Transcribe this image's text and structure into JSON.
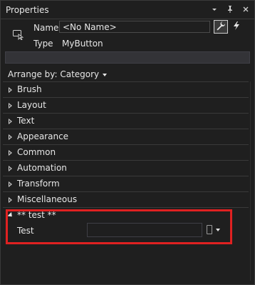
{
  "window": {
    "title": "Properties",
    "controls": [
      {
        "name": "dropdown-caret",
        "glyph": "▾"
      },
      {
        "name": "pin",
        "glyph": "📌"
      },
      {
        "name": "close",
        "glyph": "✕"
      }
    ]
  },
  "header": {
    "name_label": "Name",
    "name_value": "<No Name>",
    "type_label": "Type",
    "type_value": "MyButton",
    "properties_icon": "wrench-icon",
    "events_icon": "lightning-icon"
  },
  "search": {
    "placeholder": ""
  },
  "arrange": {
    "label": "Arrange by: Category"
  },
  "categories": [
    {
      "label": "Brush"
    },
    {
      "label": "Layout"
    },
    {
      "label": "Text"
    },
    {
      "label": "Appearance"
    },
    {
      "label": "Common"
    },
    {
      "label": "Automation"
    },
    {
      "label": "Transform"
    },
    {
      "label": "Miscellaneous"
    }
  ],
  "test_category": {
    "label": "** test **",
    "property": {
      "label": "Test",
      "value": ""
    }
  },
  "colors": {
    "background": "#1f1f1f",
    "highlight": "#e02121",
    "text": "#e6e6e6"
  }
}
